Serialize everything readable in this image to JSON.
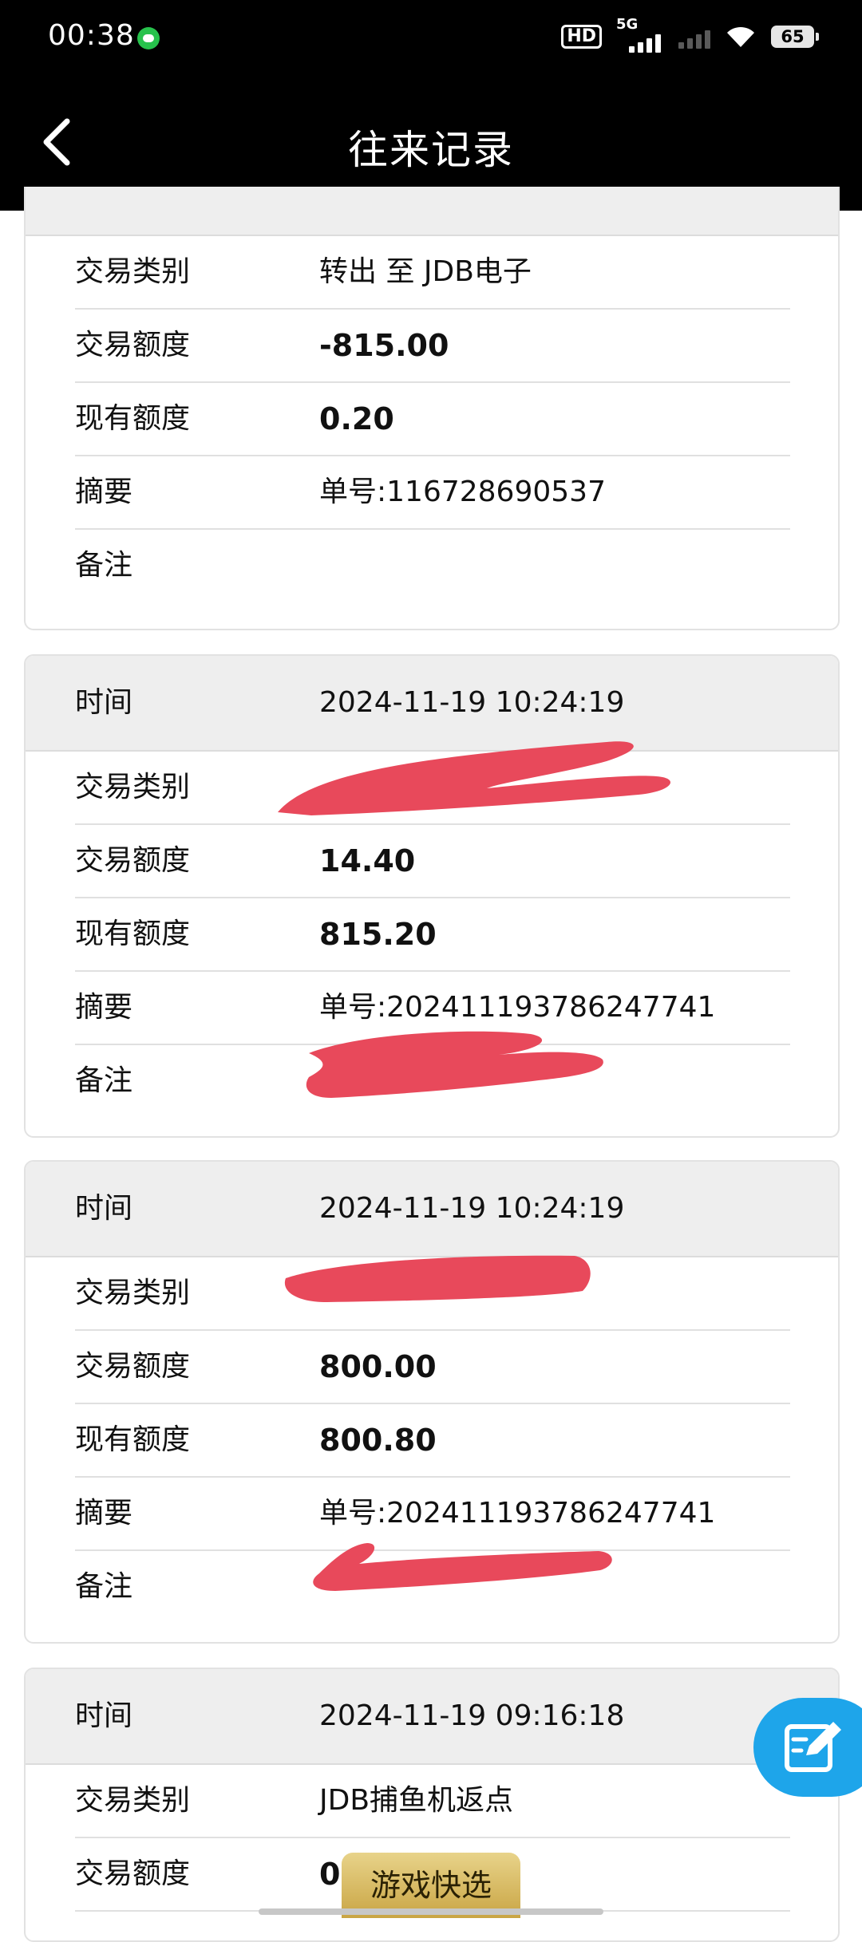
{
  "status_bar": {
    "time": "00:38",
    "network_hd": "HD",
    "network_5g": "5G",
    "battery": "65"
  },
  "header": {
    "title": "往来记录"
  },
  "labels": {
    "time": "时间",
    "category": "交易类别",
    "amount": "交易额度",
    "balance": "现有额度",
    "summary": "摘要",
    "note": "备注"
  },
  "records": [
    {
      "time": "",
      "category": "转出 至 JDB电子",
      "amount": "-815.00",
      "balance": "0.20",
      "summary": "单号:116728690537",
      "note": ""
    },
    {
      "time": "2024-11-19 10:24:19",
      "category": "",
      "amount": "14.40",
      "balance": "815.20",
      "summary": "单号:202411193786247741",
      "note": ""
    },
    {
      "time": "2024-11-19 10:24:19",
      "category": "",
      "amount": "800.00",
      "balance": "800.80",
      "summary": "单号:202411193786247741",
      "note": ""
    },
    {
      "time": "2024-11-19 09:16:18",
      "category": "JDB捕鱼机返点",
      "amount": "0.",
      "balance": "",
      "summary": "",
      "note": ""
    }
  ],
  "quick_select_button": "游戏快选",
  "colors": {
    "header_bg": "#000000",
    "card_head_bg": "#eeeeee",
    "redaction": "#e8495b",
    "fab": "#1ea5ea",
    "quick_gold": "#d4b45a"
  }
}
